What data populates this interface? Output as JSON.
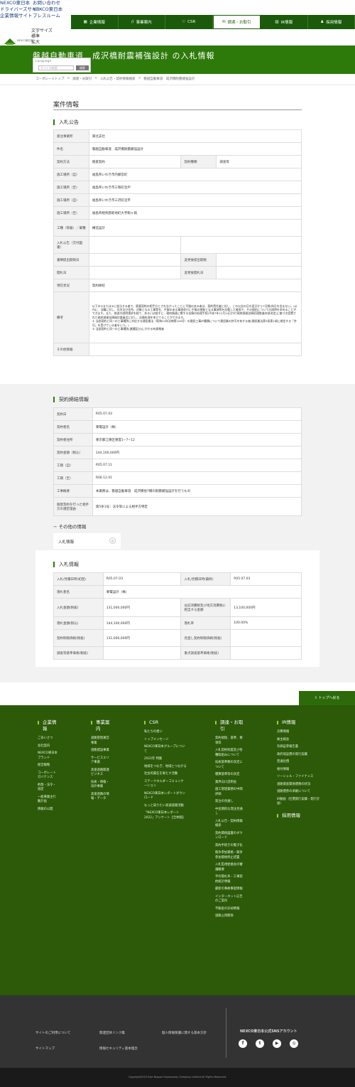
{
  "utility": {
    "links": [
      "NEXCO東日本",
      "ドライバーズサイト",
      "企業情報サイト"
    ],
    "right_links": [
      "お問い合わせ",
      "NEXCO東日本",
      "プレスルーム"
    ],
    "size_label": "文字サイズ",
    "size_std": "標準",
    "size_big": "拡大"
  },
  "gnav": [
    {
      "label": "企業情報",
      "icon": "building-icon"
    },
    {
      "label": "事業案内",
      "icon": "road-icon"
    },
    {
      "label": "CSR",
      "icon": "heart-icon"
    },
    {
      "label": "調達・お取引",
      "icon": "handshake-icon"
    },
    {
      "label": "IR情報",
      "icon": "chart-icon"
    },
    {
      "label": "採用情報",
      "icon": "person-icon"
    }
  ],
  "logo_text": "NEXCO東日本",
  "hero": {
    "title": "磐越自動車道　成沢橋耐震補強設計 の入札情報"
  },
  "lang": {
    "label": "Language",
    "search_placeholder": "サイト内検索",
    "search_btn": "検索"
  },
  "breadcrumb": [
    "コーポレートトップ",
    "調達・お取引",
    "入札公告・契約情報検索",
    "磐越自動車道　成沢橋耐震補強設計"
  ],
  "case": {
    "title": "案件情報",
    "sub": "入札公告",
    "rows1": [
      [
        "発注事業所",
        "東北支社"
      ],
      [
        "件名",
        "磐越自動車道　成沢橋耐震補強設計"
      ]
    ],
    "method_key": "契約方法",
    "method_val": "随意契約",
    "kind_key": "契約種類",
    "kind_val": "調査等",
    "rows2": [
      [
        "施工場所（自）",
        "福島県いわき市内郷宮町"
      ],
      [
        "施工場所（至）",
        "福島県いわき市三和町合戸"
      ],
      [
        "施工場所（自）",
        "福島県いわき市三沢町沼平"
      ],
      [
        "施工場所（至）",
        "福島県相馬郡新地町大字駒ヶ嶺"
      ]
    ],
    "work_key": "工種（等級）／業種",
    "work_val": "構造設計",
    "announce_key": "入札公告（交付図書）",
    "doc_key": "書類提出期限日",
    "change_doc_key": "変更後提出期限",
    "open_key": "開札日",
    "change_open_key": "変更後開札日",
    "status_key": "現在状況",
    "status_val": "契約締結",
    "note_key": "備考",
    "note_lines": [
      "以下の①または②に該当する者で、随意契約の相手方とされなかったことに不服のある者は、契約責任者に対し、この公告の日の翌日から7日間(休日を含まない。)以内に、当職に対し、氏名及び住所、対象となる工事等名、不服のある事項並びに不服の根拠となる事項等を記載した書面で、その理由についての説明を求めることができます。また、前述の説明請求を経て、あるいは経ずに、政府調達に関する苦情の処理手続(平成7年12月14日付け政府調達苦情処理推進本部決定)に基づき設置された政府調達苦情検討委員会に対し、苦情処理を申立てることができます。",
      "① 当該契約と同一の工事種別に対応する建設業法（昭和24年法律第100号）の建設工事の種類について建設業の許可を有する者(建設業法第3条第1項に規定する「許可」を受けている者をいう。)",
      "② 当該契約と同一の工事種別(業種区分)にかかる有資格者"
    ],
    "other_key": "その他情報"
  },
  "contract": {
    "title": "契約締結情報",
    "rows": [
      [
        "契約日",
        "R05.07.03"
      ],
      [
        "契約者名",
        "東電設計（株）"
      ],
      [
        "契約者住所",
        "東京都江東区東雲1−7−12"
      ],
      [
        "契約金額（税込）",
        "144,100,000円"
      ],
      [
        "工期（自）",
        "R05.07.11"
      ],
      [
        "工期（至）",
        "R06.12.01"
      ],
      [
        "工事概要",
        "本業務は、磐越自動車道　成沢橋他7橋の耐震補強設計を行うもの"
      ],
      [
        "随意契約を行った相手方の選定理由",
        "第5条1号：法令等による相手方特定"
      ]
    ]
  },
  "other": {
    "title": "その他の情報",
    "tab": "入札情報",
    "tab_icon": "chevron-icon",
    "bid_title": "入札情報",
    "rows": [
      [
        "入札/見積日時(初回)",
        "R05.07.03",
        "入札/見積日時(最終)",
        "R05.07.03"
      ],
      [
        "落札者名",
        "東電設計（株）",
        "",
        ""
      ],
      [
        "入札金額(税抜)",
        "131,000,000円",
        "左記消費税及び地方消費税に相当する金額",
        "13,100,000円"
      ],
      [
        "落札金額(税込)",
        "144,100,000円",
        "落札率",
        "100.00%"
      ],
      [
        "契約制限価格(税抜)",
        "131,000,000円",
        "見直し契約制限価格(税抜)",
        ""
      ],
      [
        "調査等基準価格(税抜)",
        "",
        "重点調査基準価格(税抜)",
        ""
      ]
    ]
  },
  "pagetop": "トップへ戻る",
  "footer": {
    "cols": [
      {
        "title": "企業情報",
        "items": [
          "ごあいさつ",
          "会社案内",
          "NEXCO東日本ブランド",
          "経営戦略",
          "コーポレートガバナンス",
          "約款・法令・協定",
          "一般事業主行動計画",
          "情報の公開"
        ]
      },
      {
        "title": "事業案内",
        "items": [
          "道路管理運営事業",
          "道路建設事業",
          "サービスエリア事業",
          "高速道路関連ビジネス",
          "技術・情報・海外事業",
          "高速道路の情報・データ"
        ]
      },
      {
        "title": "CSR",
        "items": [
          "私たちの想い",
          "トップメッセージ",
          "NEXCO東日本グループについて",
          "2022年 特集",
          "地域をつなぎ、地域とつながる",
          "社会的責任を果たす活動",
          "ステークホルダーコミュニケーション",
          "NEXCO東日本レポートダウンロード",
          "もっと知りたい高速道路活動",
          "「NEXCO東日本レポート2022」アンケート【全体版】"
        ]
      },
      {
        "title": "調達・お取引",
        "items": [
          "契約規程、基準、要領等",
          "入札契約制度及び各種取組みについて",
          "技術基準類の改定について",
          "積算基準等の改定",
          "業界向け説明会",
          "施工管理業務の中間評価",
          "発注の見通し",
          "中長期的な発注見通し",
          "入札公告・契約情報検索",
          "契約関係図書のダウンロード",
          "契約手続きの電子化",
          "競争参加資格・競争参加資格停止措置",
          "入札監視委員会の審議概要",
          "平均落札率・工事契約統計情報",
          "最新の事故事案情報",
          "インターネット広告のご案内",
          "不動産の売却情報",
          "道路占用関係"
        ]
      },
      {
        "title": "IR情報",
        "items": [
          "決算情報",
          "株主総会",
          "有価証券報告書",
          "政府保証債の発行実績",
          "普通社債",
          "格付情報",
          "ソーシャル・ファイナンス",
          "道路資産関係債務の状況",
          "道路債券の承継について",
          "IR動画（社債発行実績・発行計画）"
        ]
      }
    ],
    "recruit": "採用情報",
    "bottom_links": [
      "サイトのご利用について",
      "関連団体リンク集",
      "個人情報保護に関する基本方針",
      "サイトマップ",
      "情報セキュリティ基本理念"
    ],
    "sns_title": "NEXCO東日本公式SNSアカウント",
    "sns": [
      {
        "icon": "facebook-icon",
        "glyph": "f"
      },
      {
        "icon": "twitter-icon",
        "glyph": "t"
      },
      {
        "icon": "youtube-icon",
        "glyph": "▶"
      },
      {
        "icon": "instagram-icon",
        "glyph": "◎"
      }
    ],
    "copyright": "Copyright2020 East Nippon Expressway Company Limited All Rights Reserved."
  },
  "colors": {
    "brand": "#2d7a0a",
    "nav": "#1a5a0a",
    "footer": "#2c5a08"
  }
}
